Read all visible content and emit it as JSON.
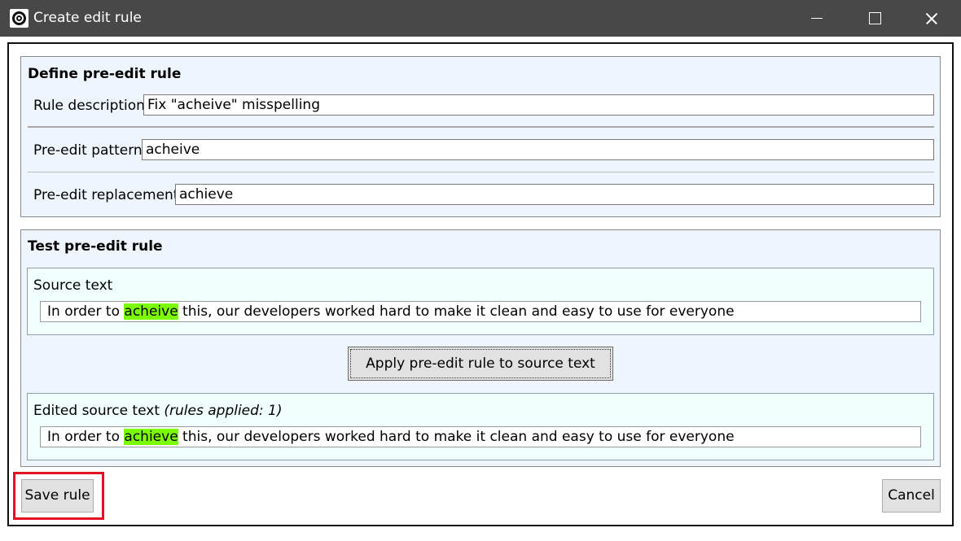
{
  "window": {
    "title": "Create edit rule"
  },
  "define": {
    "heading": "Define pre-edit rule",
    "description_label": "Rule description",
    "description_value": "Fix \"acheive\" misspelling",
    "pattern_label": "Pre-edit pattern",
    "pattern_value": "acheive",
    "replacement_label": "Pre-edit replacement",
    "replacement_value": "achieve"
  },
  "test": {
    "heading": "Test pre-edit rule",
    "source_label": "Source text",
    "source": {
      "before": "In order to ",
      "match": "acheive",
      "after": " this, our developers worked hard to make it clean and easy to use for everyone"
    },
    "apply_button_label": "Apply pre-edit rule to source text",
    "edited_label": "Edited source text ",
    "edited_label_note": "(rules applied: 1)",
    "edited": {
      "before": "In order to ",
      "match": "achieve",
      "after": " this, our developers worked hard to make it clean and easy to use for everyone"
    }
  },
  "footer": {
    "save_label": "Save rule",
    "cancel_label": "Cancel"
  },
  "colors": {
    "match_highlight": "#7cfc00",
    "callout_border": "#e0141e",
    "titlebar": "#484848"
  }
}
